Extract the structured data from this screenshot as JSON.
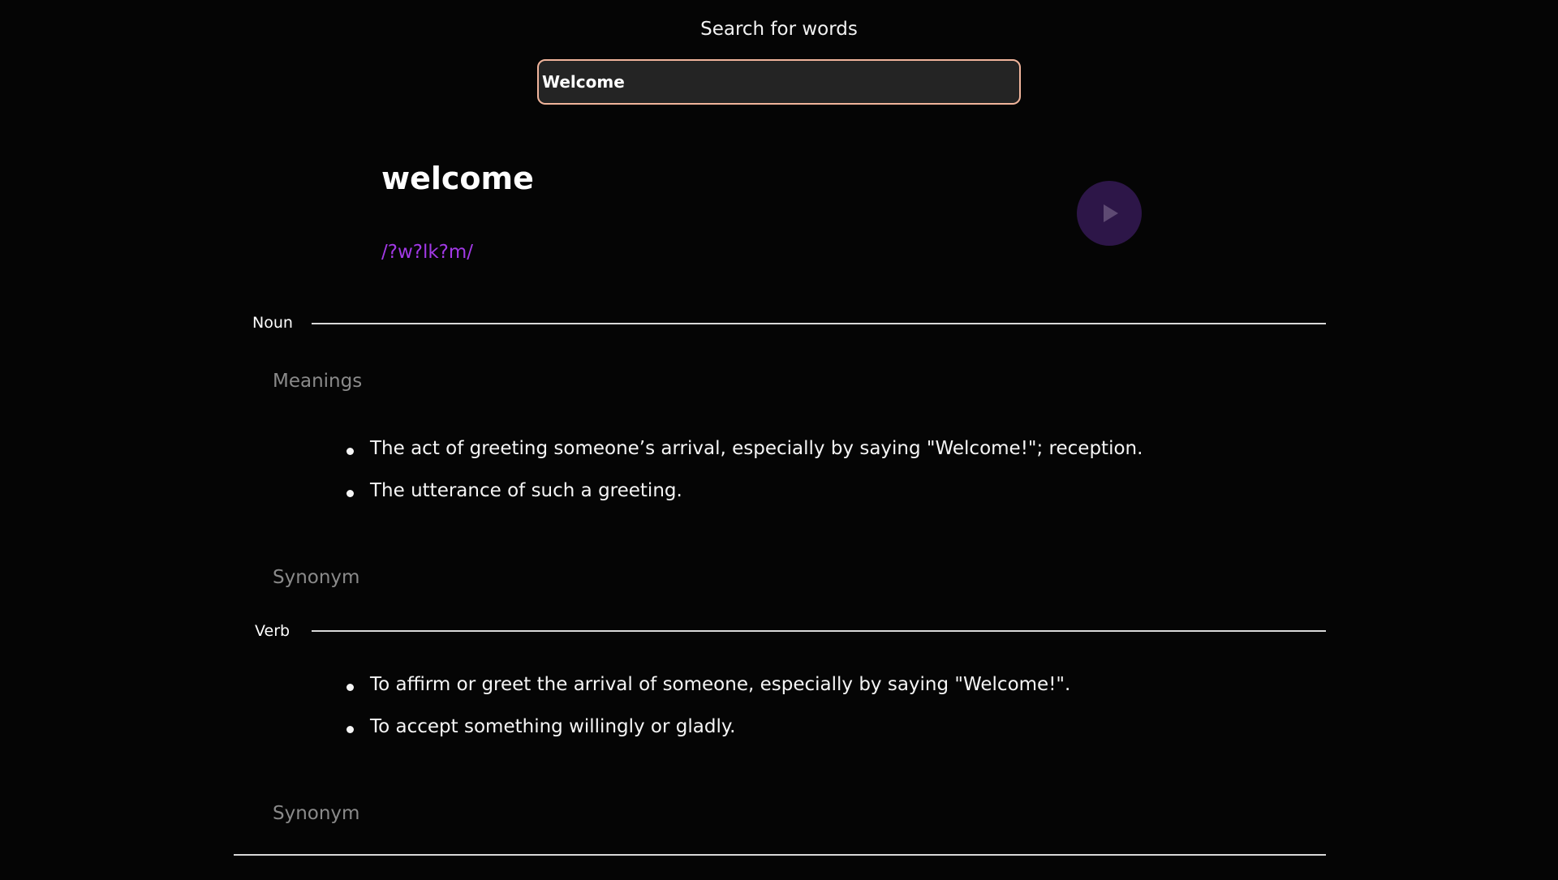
{
  "search": {
    "label": "Search for words",
    "value": "Welcome",
    "border_color": "#f0b49b"
  },
  "entry": {
    "word": "welcome",
    "phonetic": "/?w?lk?m/",
    "phonetic_color": "#a239e6",
    "play_icon": "play-icon",
    "play_button_color": "#2d1648"
  },
  "meanings": [
    {
      "part_of_speech": "Noun",
      "heading": "Meanings",
      "definitions": [
        "The act of greeting someone’s arrival, especially by saying \"Welcome!\"; reception.",
        "The utterance of such a greeting."
      ],
      "synonym_heading": "Synonym"
    },
    {
      "part_of_speech": "Verb",
      "definitions": [
        "To affirm or greet the arrival of someone, especially by saying \"Welcome!\".",
        "To accept something willingly or gladly."
      ],
      "synonym_heading": "Synonym"
    }
  ]
}
